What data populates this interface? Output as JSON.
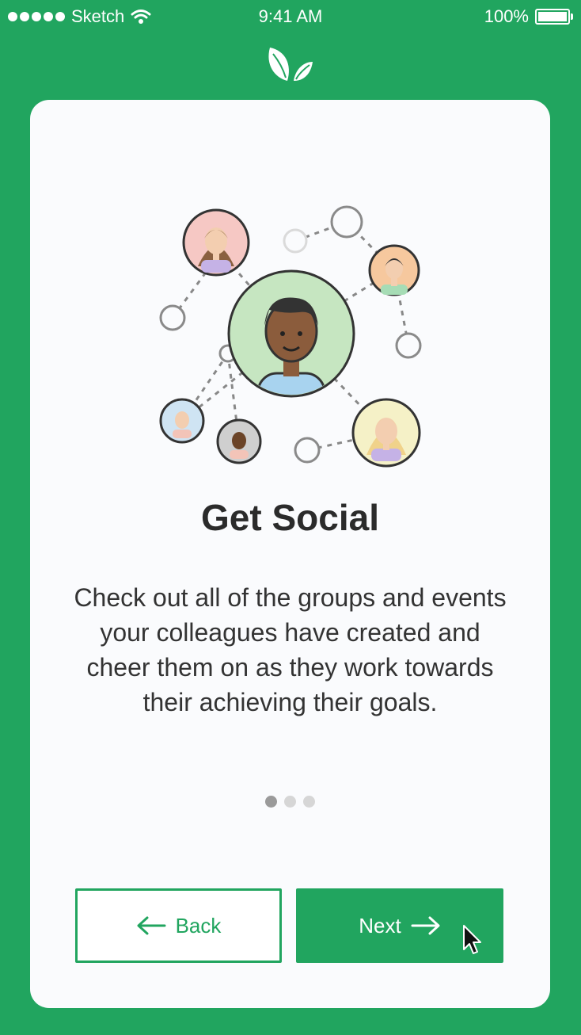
{
  "status_bar": {
    "carrier": "Sketch",
    "time": "9:41 AM",
    "battery": "100%",
    "signal_icon": "signal-dots-icon",
    "wifi_icon": "wifi-icon",
    "battery_icon": "battery-icon"
  },
  "logo_icon": "leaf-logo-icon",
  "onboarding": {
    "title": "Get Social",
    "description": "Check out all of the groups and events your colleagues have created and cheer them on as they work towards their achieving their goals.",
    "page_index": 1,
    "page_count": 3
  },
  "buttons": {
    "back_label": "Back",
    "next_label": "Next",
    "back_icon": "arrow-left-icon",
    "next_icon": "arrow-right-icon"
  },
  "colors": {
    "brand_green": "#21a55f",
    "card_bg": "#fafbfd",
    "title_text": "#2b2b2b"
  }
}
